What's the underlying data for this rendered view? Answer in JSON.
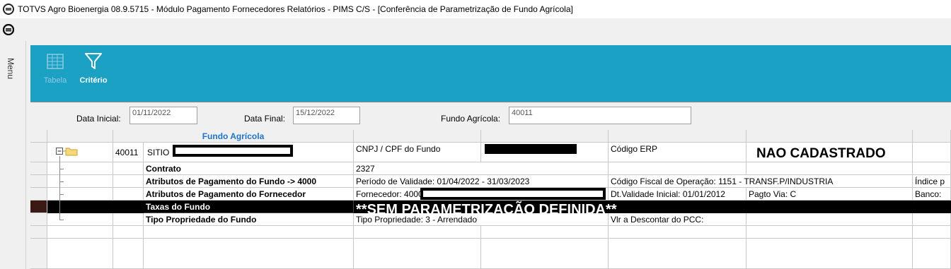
{
  "window": {
    "title": "TOTVS Agro Bioenergia 08.9.5715 - Módulo Pagamento Fornecedores Relatórios - PIMS C/S - [Conferência de Parametrização de Fundo Agrícola]"
  },
  "sidebar": {
    "menu_label": "Menu"
  },
  "toolbar": {
    "tabela_label": "Tabela",
    "criterio_label": "Critério"
  },
  "filters": {
    "data_inicial_label": "Data Inicial:",
    "data_inicial_value": "01/11/2022",
    "data_final_label": "Data Final:",
    "data_final_value": "15/12/2022",
    "fundo_label": "Fundo Agrícola:",
    "fundo_value": "40011"
  },
  "grid": {
    "header": "Fundo Agrícola",
    "root": {
      "code": "40011",
      "name": "SITIO",
      "cnpj_label": "CNPJ / CPF do Fundo",
      "erp_label": "Código ERP",
      "erp_status": "NAO CADASTRADO"
    },
    "rows": [
      {
        "label": "Contrato",
        "c1": "2327",
        "c3": "",
        "c4": "",
        "c5": ""
      },
      {
        "label": "Atributos de Pagamento do Fundo -> 4000",
        "c1": "Período de Validade: 01/04/2022 - 31/03/2023",
        "c3": "Código Fiscal de Operação: 1151 - TRANSF.P/INDUSTRIA",
        "c4": "",
        "c5": "Índice p"
      },
      {
        "label": "Atributos de Pagamento do Fornecedor",
        "c1": "Fornecedor: 4000",
        "c3": "Dt.Validade Inicial: 01/01/2012",
        "c4": "Pagto Via: C",
        "c5": "Banco:"
      },
      {
        "label": "Taxas do Fundo",
        "c1": "**SEM PARAMETRIZAÇÃO DEFINIDA**",
        "c3": "",
        "c4": "",
        "c5": ""
      },
      {
        "label": "Tipo Propriedade do Fundo",
        "c1": "Tipo Propriedade: 3 - Arrendado",
        "c3": "Vlr a Descontar do PCC:",
        "c4": "",
        "c5": ""
      }
    ]
  }
}
